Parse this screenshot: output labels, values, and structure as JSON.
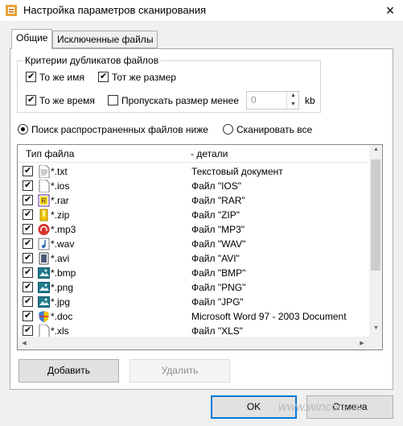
{
  "window": {
    "title": "Настройка параметров сканирования"
  },
  "tabs": [
    "Общие",
    "Исключенные файлы"
  ],
  "criteria": {
    "legend": "Критерии дубликатов файлов",
    "same_name": "То же имя",
    "same_size": "Тот же размер",
    "same_time": "То же время",
    "skip_size_less": "Пропускать размер менее",
    "size_value": "0",
    "size_unit": "kb"
  },
  "scan_mode": {
    "common_files": "Поиск распространенных файлов ниже",
    "scan_all": "Сканировать все"
  },
  "file_list": {
    "columns": [
      "Тип файла",
      "- детали"
    ],
    "rows": [
      {
        "ext": "*.txt",
        "details": "Текстовый документ",
        "icon": "text-file-icon"
      },
      {
        "ext": "*.ios",
        "details": "Файл \"IOS\"",
        "icon": "blank-file-icon"
      },
      {
        "ext": "*.rar",
        "details": "Файл \"RAR\"",
        "icon": "rar-archive-icon"
      },
      {
        "ext": "*.zip",
        "details": "Файл \"ZIP\"",
        "icon": "zip-archive-icon"
      },
      {
        "ext": "*.mp3",
        "details": "Файл \"MP3\"",
        "icon": "headphones-icon"
      },
      {
        "ext": "*.wav",
        "details": "Файл \"WAV\"",
        "icon": "music-note-icon"
      },
      {
        "ext": "*.avi",
        "details": "Файл \"AVI\"",
        "icon": "video-file-icon"
      },
      {
        "ext": "*.bmp",
        "details": "Файл \"BMP\"",
        "icon": "image-file-icon"
      },
      {
        "ext": "*.png",
        "details": "Файл \"PNG\"",
        "icon": "image-file-icon"
      },
      {
        "ext": "*.jpg",
        "details": "Файл \"JPG\"",
        "icon": "image-file-icon"
      },
      {
        "ext": "*.doc",
        "details": "Microsoft Word 97 - 2003 Document",
        "icon": "shield-icon"
      },
      {
        "ext": "*.xls",
        "details": "Файл \"XLS\"",
        "icon": "blank-file-icon"
      }
    ]
  },
  "buttons": {
    "add": "Добавить",
    "remove": "Удалить",
    "ok": "OK",
    "cancel": "Отмена"
  },
  "watermark": "www.wincore.ru"
}
